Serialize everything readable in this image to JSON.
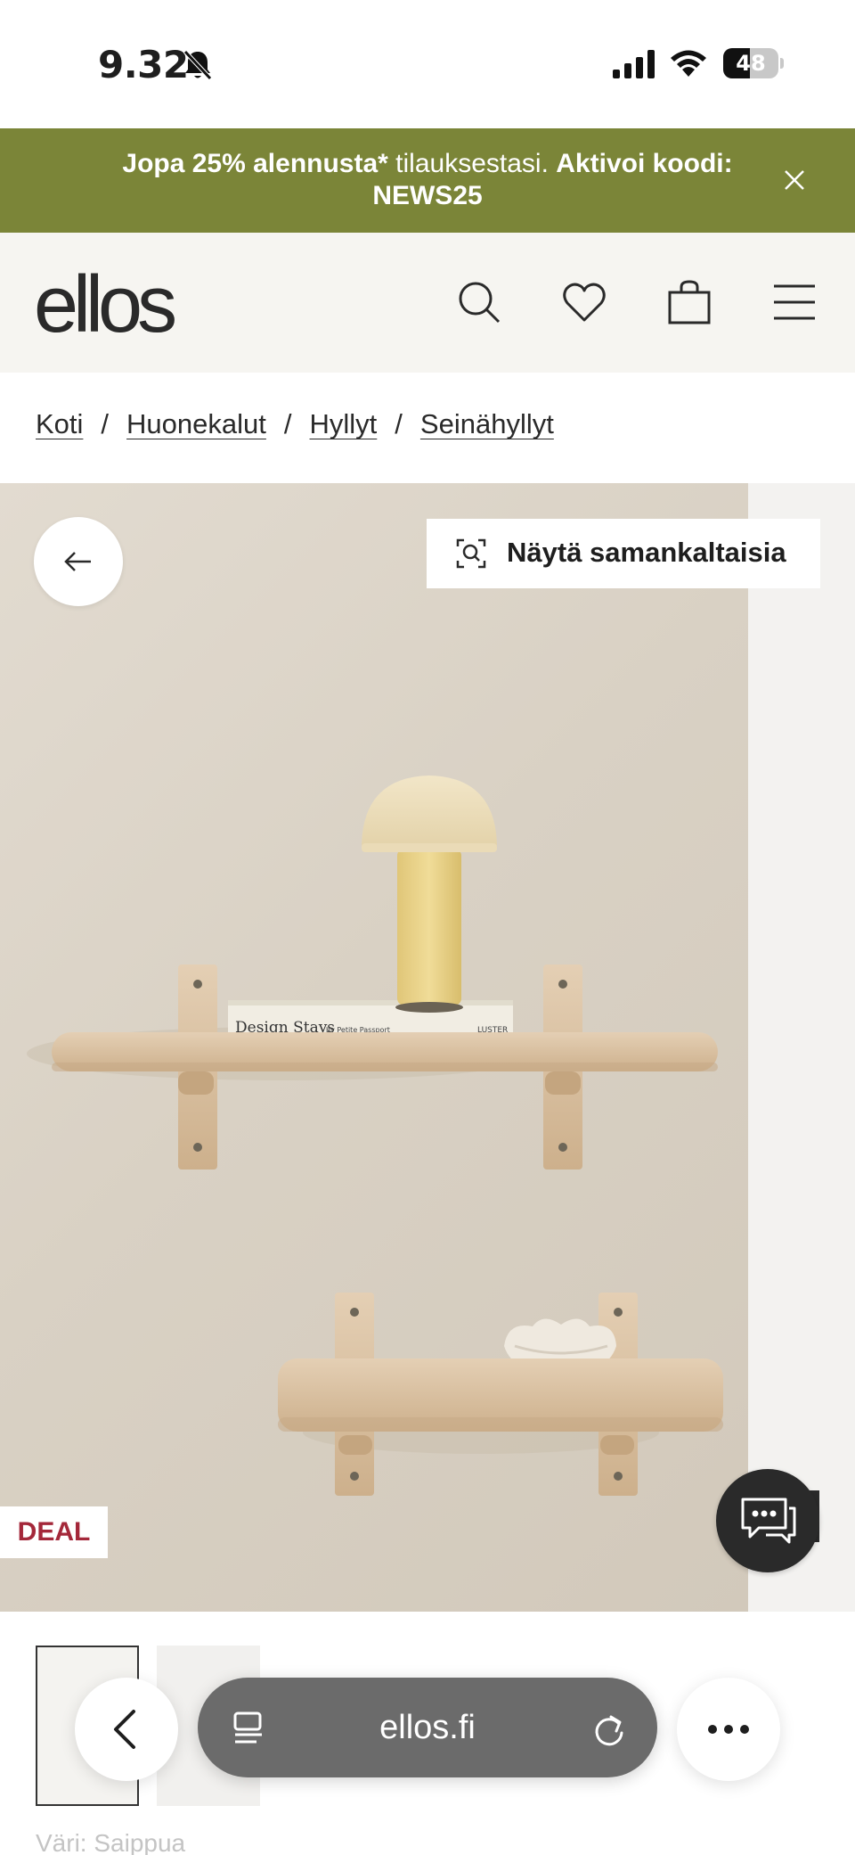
{
  "status_bar": {
    "time": "9.32",
    "battery": "48",
    "battery_level": 0.48
  },
  "promo": {
    "part1": "Jopa 25% alennusta*",
    "part2": " tilauksestasi. ",
    "part3": "Aktivoi koodi: NEWS25"
  },
  "header": {
    "logo": "ellos",
    "icons": [
      "search-icon",
      "heart-icon",
      "bag-icon",
      "menu-icon"
    ]
  },
  "breadcrumb": {
    "items": [
      "Koti",
      "Huonekalut",
      "Hyllyt",
      "Seinähyllyt"
    ],
    "separator": "/"
  },
  "gallery": {
    "similar_label": "Näytä samankaltaisia",
    "deal_label": "DEAL",
    "book_title": "Design Stays",
    "book_subtitle": "by Petite Passport",
    "book_publisher": "LUSTER"
  },
  "product": {
    "color_line": "Väri: Saippua"
  },
  "browser": {
    "url": "ellos.fi"
  },
  "colors": {
    "promo_bg": "#7b8538",
    "header_bg": "#f6f5f1",
    "deal_red": "#a4283a",
    "url_pill": "#6b6b6b"
  }
}
